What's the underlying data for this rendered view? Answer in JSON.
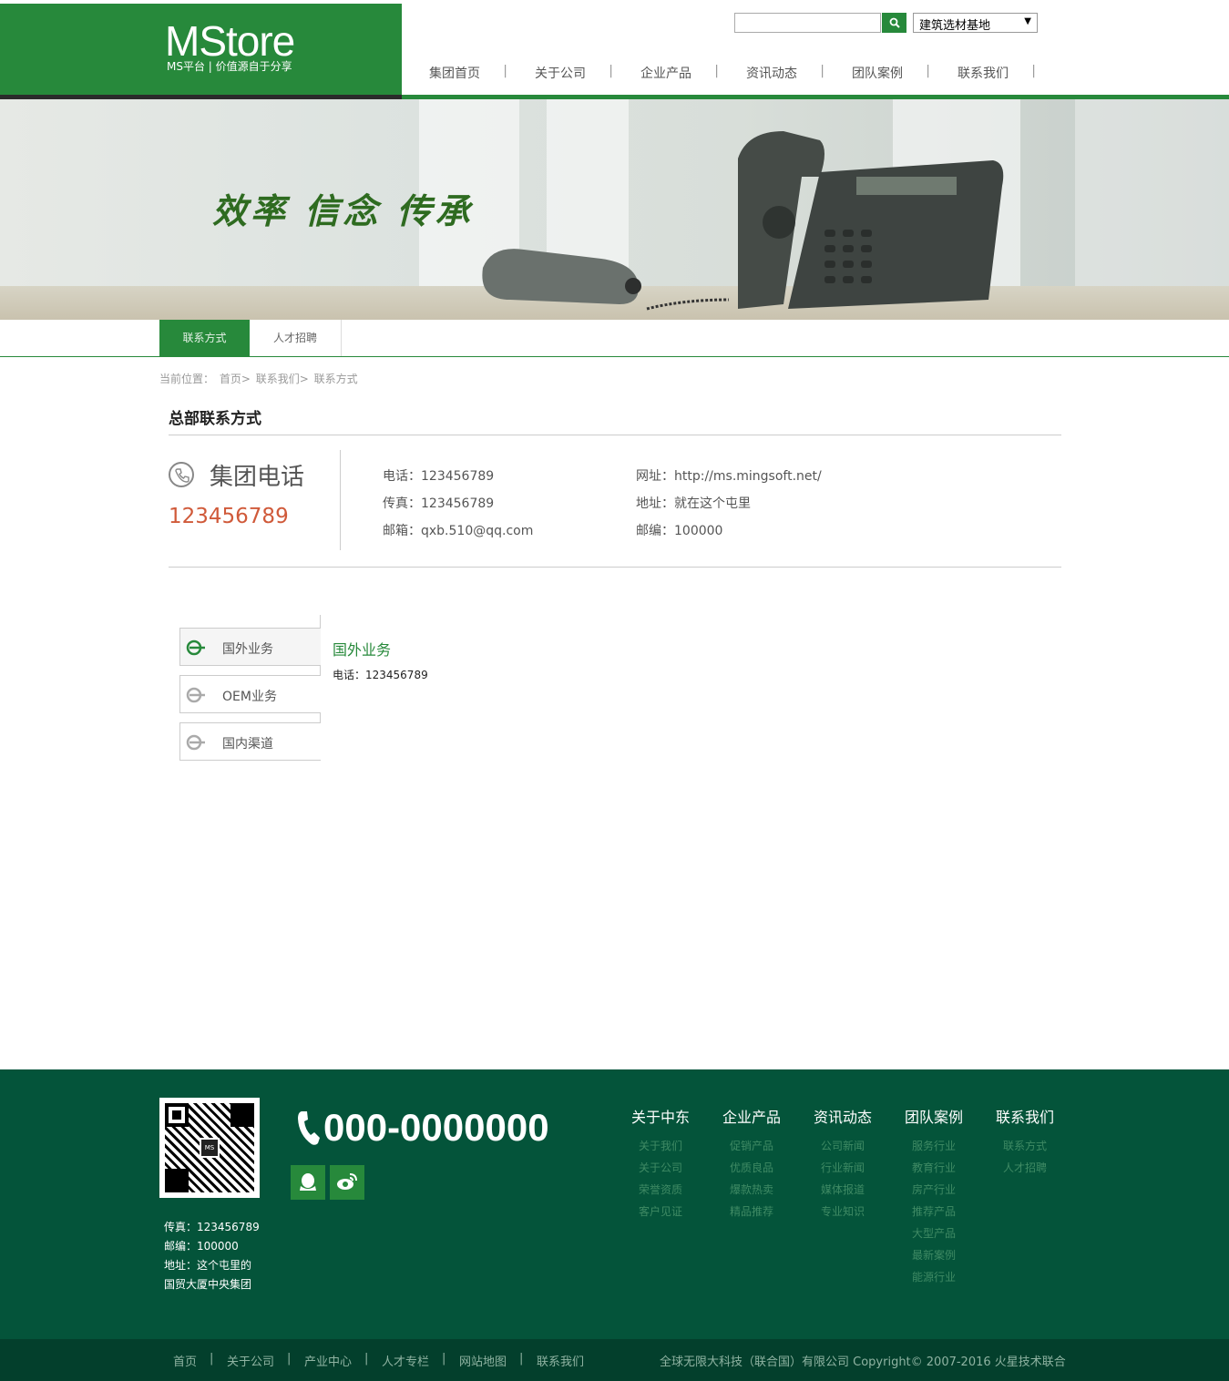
{
  "header": {
    "logo": "MStore",
    "slogan": "MS平台 | 价值源自于分享",
    "search_placeholder": "",
    "site_select": "建筑选材基地",
    "nav": [
      "集团首页",
      "关于公司",
      "企业产品",
      "资讯动态",
      "团队案例",
      "联系我们"
    ]
  },
  "banner": {
    "slogan": "效率 信念 传承"
  },
  "subnav": {
    "tabs": [
      "联系方式",
      "人才招聘"
    ],
    "active": 0
  },
  "breadcrumb": {
    "prefix": "当前位置：",
    "items": [
      "首页>",
      "联系我们>",
      "联系方式"
    ]
  },
  "contact": {
    "section_title": "总部联系方式",
    "group_phone_title": "集团电话",
    "group_phone_number": "123456789",
    "info_left": [
      "电话：123456789",
      "传真：123456789",
      "邮箱：qxb.510@qq.com"
    ],
    "info_right": [
      "网址：http://ms.mingsoft.net/",
      "地址：就在这个屯里",
      "邮编：100000"
    ]
  },
  "business": {
    "tabs": [
      "国外业务",
      "OEM业务",
      "国内渠道"
    ],
    "active": 0,
    "title": "国外业务",
    "text": "电话：123456789"
  },
  "footer": {
    "qr_badge": "MS",
    "contact_lines": [
      "传真：123456789",
      "邮编：100000",
      "地址：这个屯里的",
      "国贸大厦中央集团"
    ],
    "phone": "000-0000000",
    "columns": [
      {
        "title": "关于中东",
        "links": [
          "关于我们",
          "关于公司",
          "荣誉资质",
          "客户见证"
        ]
      },
      {
        "title": "企业产品",
        "links": [
          "促销产品",
          "优质良品",
          "爆款热卖",
          "精品推荐"
        ]
      },
      {
        "title": "资讯动态",
        "links": [
          "公司新闻",
          "行业新闻",
          "媒体报道",
          "专业知识"
        ]
      },
      {
        "title": "团队案例",
        "links": [
          "服务行业",
          "教育行业",
          "房产行业",
          "推荐产品",
          "大型产品",
          "最新案例",
          "能源行业"
        ]
      },
      {
        "title": "联系我们",
        "links": [
          "联系方式",
          "人才招聘"
        ]
      }
    ],
    "bottom_links": [
      "首页",
      "关于公司",
      "产业中心",
      "人才专栏",
      "网站地图",
      "联系我们"
    ],
    "copyright": "全球无限大科技（联合国）有限公司 Copyright© 2007-2016 火星技术联合"
  },
  "colors": {
    "brand_green": "#27893b",
    "footer_green": "#04543a",
    "phone_accent": "#d05a3a"
  },
  "icons": [
    "search-icon",
    "phone-circle-icon",
    "business-tab-icon",
    "handset-icon",
    "qq-icon",
    "weibo-icon"
  ]
}
